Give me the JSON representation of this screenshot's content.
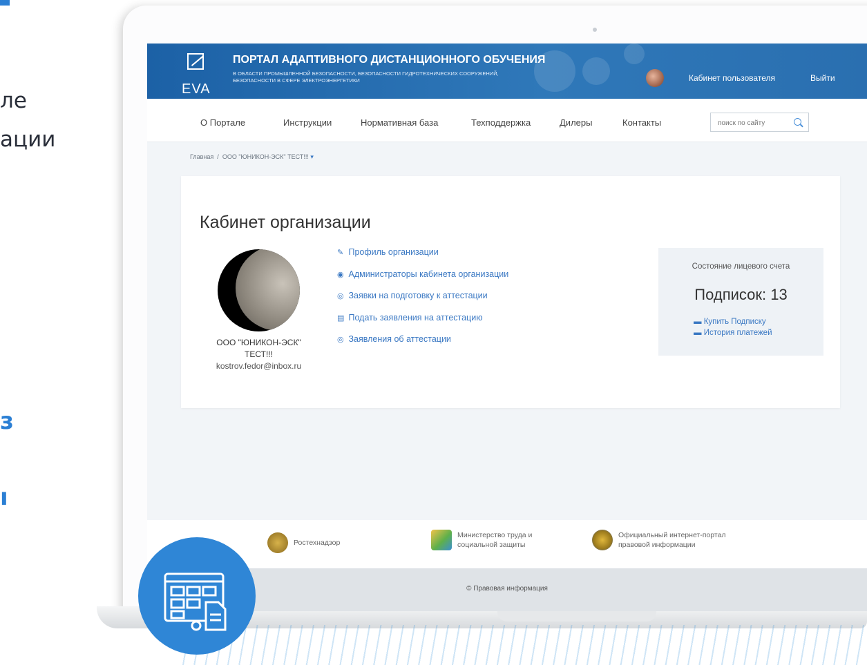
{
  "background_text": {
    "line1": "ле",
    "line2": "ации",
    "frag1": "з",
    "frag2": "ı"
  },
  "colors": {
    "brand_blue": "#2f78b9",
    "link_blue": "#3a78c3",
    "badge_blue": "#2f86d6"
  },
  "header": {
    "logo_text": "EVA",
    "title": "ПОРТАЛ АДАПТИВНОГО ДИСТАНЦИОННОГО ОБУЧЕНИЯ",
    "subtitle_line1": "В ОБЛАСТИ ПРОМЫШЛЕННОЙ БЕЗОПАСНОСТИ, БЕЗОПАСНОСТИ ГИДРОТЕХНИЧЕСКИХ СООРУЖЕНИЙ,",
    "subtitle_line2": "БЕЗОПАСНОСТИ В СФЕРЕ ЭЛЕКТРОЭНЕРГЕТИКИ",
    "user_cabinet": "Кабинет пользователя",
    "logout": "Выйти"
  },
  "nav": {
    "items": [
      "О Портале",
      "Инструкции",
      "Нормативная база",
      "Техподдержка",
      "Дилеры",
      "Контакты"
    ],
    "search_placeholder": "поиск по сайту"
  },
  "breadcrumb": {
    "home": "Главная",
    "separator": "/",
    "current": "ООО \"ЮНИКОН-ЭСК\" ТЕСТ!!!"
  },
  "main": {
    "title": "Кабинет организации",
    "org_name_line1": "ООО \"ЮНИКОН-ЭСК\"",
    "org_name_line2": "ТЕСТ!!!",
    "org_email": "kostrov.fedor@inbox.ru",
    "links": [
      "Профиль организации",
      "Администраторы кабинета организации",
      "Заявки на подготовку к аттестации",
      "Подать заявления на аттестацию",
      "Заявления об аттестации"
    ]
  },
  "account": {
    "heading": "Состояние лицевого счета",
    "subscriptions": "Подписок: 13",
    "buy": "Купить Подписку",
    "history": "История платежей"
  },
  "footer": {
    "items": [
      "Ростехнадзор",
      "Министерство труда и\nсоциальной защиты",
      "Официальный интернет-портал\nправовой информации"
    ],
    "copyright": "© Правовая информация"
  }
}
